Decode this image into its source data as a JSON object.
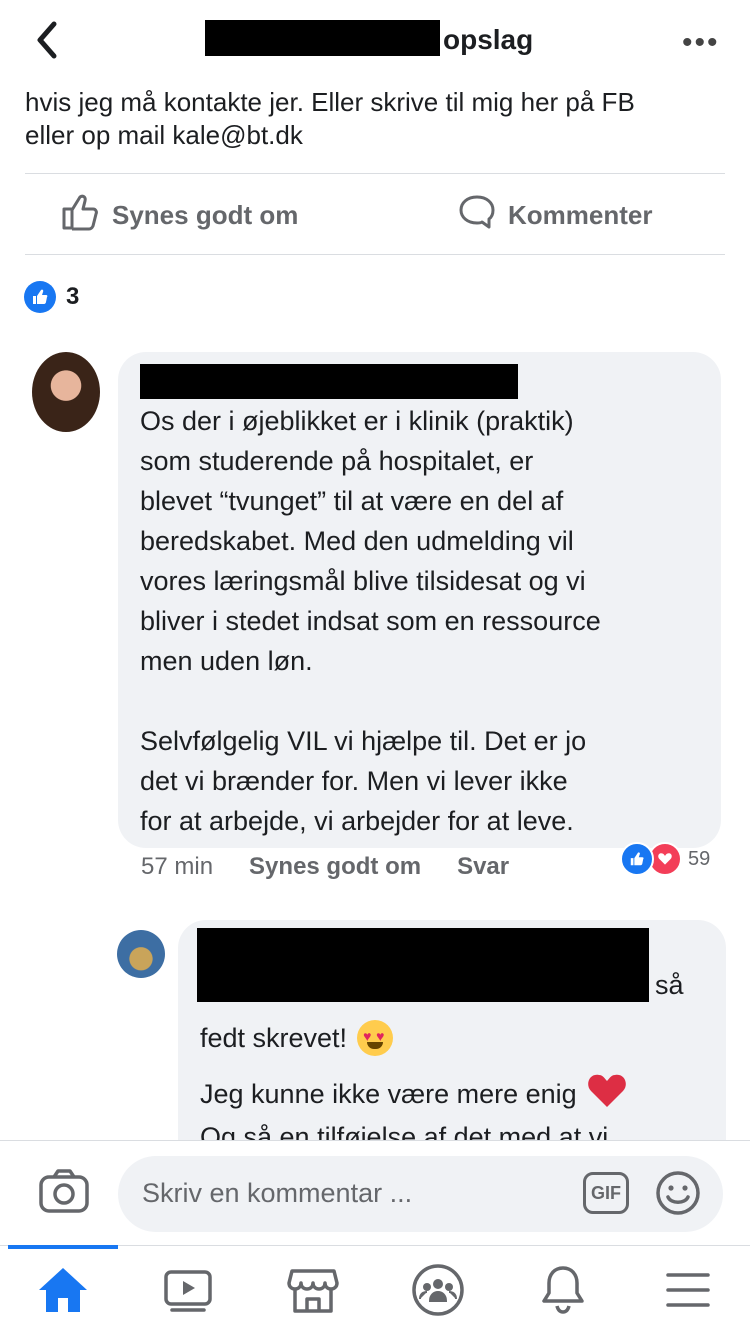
{
  "header": {
    "title": "opslag"
  },
  "post": {
    "text_lines": [
      "hvis jeg må kontakte jer. Eller skrive til mig her på FB",
      "eller op mail kale@bt.dk"
    ],
    "actions": {
      "like": "Synes godt om",
      "comment": "Kommenter"
    },
    "reaction_count": "3"
  },
  "comment1": {
    "paragraph1": [
      "Os der i øjeblikket er i klinik (praktik)",
      "som studerende på hospitalet, er",
      "blevet “tvunget” til at være en del af",
      "beredskabet. Med den udmelding vil",
      "vores læringsmål blive tilsidesat og vi",
      "bliver i stedet indsat som en ressource",
      "men uden løn."
    ],
    "paragraph2": [
      "Selvfølgelig VIL vi hjælpe til. Det er jo",
      "det vi brænder for. Men vi lever ikke",
      "for at arbejde, vi arbejder for at leve."
    ],
    "time": "57 min",
    "like_label": "Synes godt om",
    "reply_label": "Svar",
    "reactions_count": "59"
  },
  "comment2": {
    "line1": "så",
    "line2": "fedt skrevet!",
    "line3": "Jeg kunne ikke være mere enig",
    "line4": "Og så en tilføjelse af det med at vi"
  },
  "composer": {
    "placeholder": "Skriv en kommentar ...",
    "gif_label": "GIF"
  },
  "tabs": [
    "home-icon",
    "video-icon",
    "marketplace-icon",
    "groups-icon",
    "notifications-icon",
    "menu-icon"
  ],
  "colors": {
    "accent": "#1877f2",
    "love": "#f33e58",
    "bubble": "#f0f2f5",
    "muted": "#65676b"
  }
}
